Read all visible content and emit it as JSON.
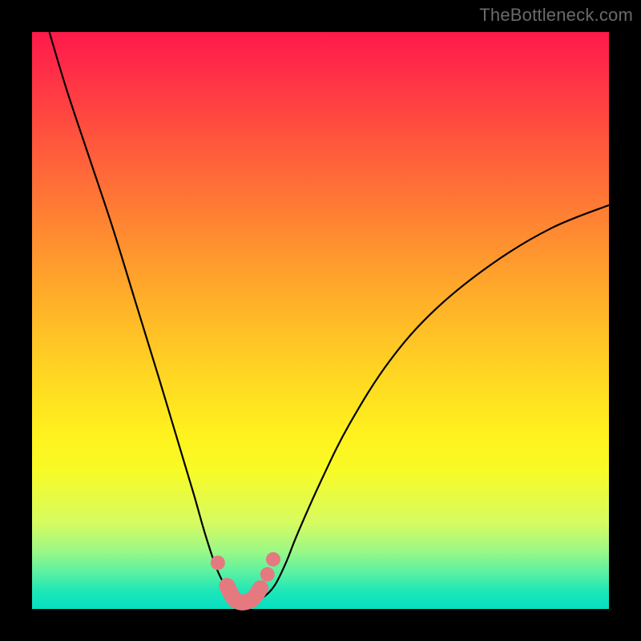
{
  "watermark": "TheBottleneck.com",
  "colors": {
    "background": "#000000",
    "gradient_top": "#ff1a4a",
    "gradient_bottom": "#05dfc2",
    "curve_stroke": "#000000",
    "marker_fill": "#e47a80"
  },
  "chart_data": {
    "type": "line",
    "title": "",
    "xlabel": "",
    "ylabel": "",
    "xlim": [
      0,
      100
    ],
    "ylim": [
      0,
      100
    ],
    "grid": false,
    "legend": false,
    "series": [
      {
        "name": "bottleneck-curve",
        "x": [
          3,
          6,
          10,
          14,
          18,
          22,
          25,
          28,
          30,
          32,
          34,
          35,
          36,
          37,
          38,
          40,
          42,
          44,
          46,
          50,
          55,
          62,
          70,
          80,
          90,
          100
        ],
        "y": [
          100,
          90,
          78,
          66,
          53,
          40,
          30,
          20,
          13,
          7,
          3,
          1.5,
          0.8,
          0.8,
          1.0,
          2,
          4,
          8,
          13,
          22,
          32,
          43,
          52,
          60,
          66,
          70
        ]
      }
    ],
    "markers": {
      "name": "highlighted-points",
      "x": [
        32.2,
        33.8,
        35.2,
        36.8,
        38.2,
        39.6,
        40.8,
        41.8
      ],
      "y": [
        8.0,
        4.0,
        1.6,
        1.2,
        1.6,
        3.6,
        6.0,
        8.6
      ]
    },
    "thick_segment": {
      "name": "optimal-range-highlight",
      "x": [
        33.8,
        35.0,
        36.0,
        37.0,
        38.3,
        39.6
      ],
      "y": [
        4.0,
        1.8,
        1.2,
        1.2,
        1.8,
        3.6
      ]
    }
  }
}
